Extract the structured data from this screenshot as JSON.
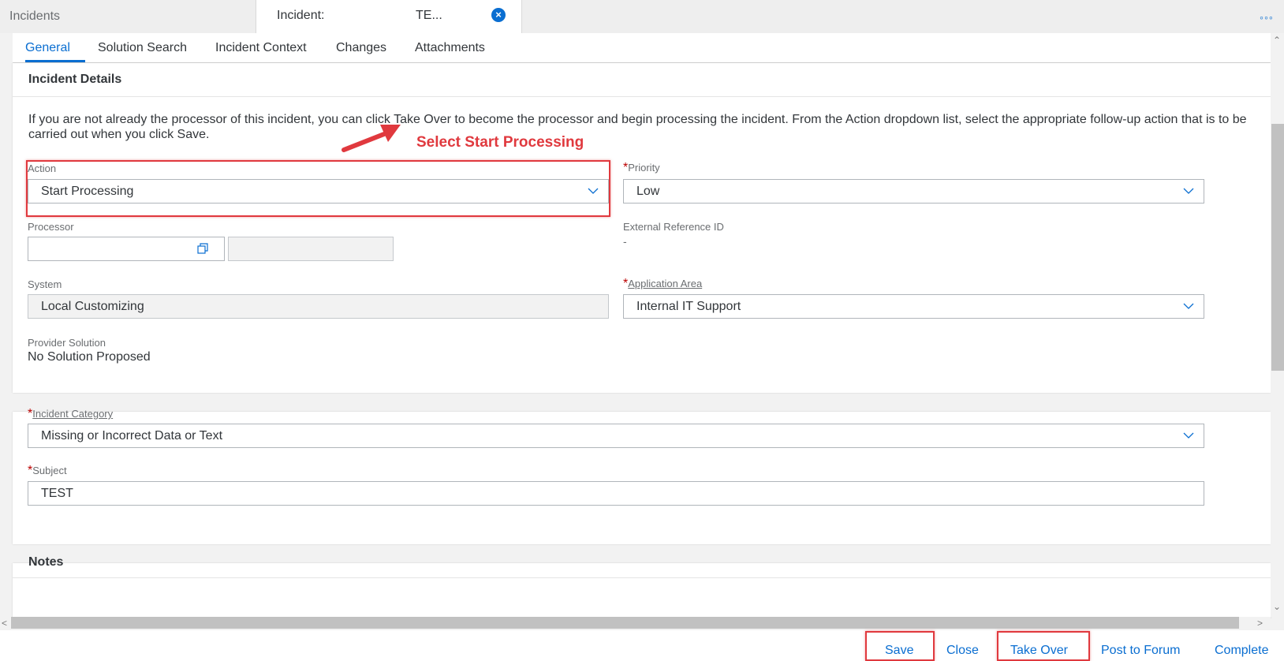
{
  "top_tabs": {
    "incidents_label": "Incidents",
    "incident_label": "Incident:",
    "incident_id": "TE...",
    "close_symbol": "×",
    "overflow_symbol": "◦◦◦"
  },
  "sub_tabs": [
    {
      "label": "General",
      "active": true
    },
    {
      "label": "Solution Search",
      "active": false
    },
    {
      "label": "Incident Context",
      "active": false
    },
    {
      "label": "Changes",
      "active": false
    },
    {
      "label": "Attachments",
      "active": false
    }
  ],
  "details": {
    "title": "Incident Details",
    "info": "If you are not already the processor of this incident, you can click Take Over to become the processor and begin processing the incident. From the Action dropdown list, select the appropriate follow-up action that is to be carried out when you click Save.",
    "action_label": "Action",
    "action_value": "Start Processing",
    "priority_label": "Priority",
    "priority_value": "Low",
    "processor_label": "Processor",
    "processor_value": "",
    "processor_name": "",
    "external_ref_label": "External Reference ID",
    "external_ref_value": "-",
    "system_label": "System",
    "system_value": "Local Customizing",
    "app_area_label": "Application Area",
    "app_area_value": "Internal IT Support",
    "provider_solution_label": "Provider Solution",
    "provider_solution_value": "No Solution Proposed",
    "required_marker": "*"
  },
  "annotation": {
    "text": "Select Start Processing",
    "color": "#e0393e"
  },
  "classification": {
    "category_label": "Incident Category",
    "category_value": "Missing or Incorrect Data or Text",
    "subject_label": "Subject",
    "subject_value": "TEST"
  },
  "notes": {
    "title": "Notes"
  },
  "footer": {
    "save": "Save",
    "close": "Close",
    "take_over": "Take Over",
    "post_to_forum": "Post to Forum",
    "complete": "Complete"
  },
  "colors": {
    "accent": "#0a6ed1",
    "required": "#bb0000",
    "highlight": "#e0393e"
  },
  "icons": {
    "chevron": "chevron-down-icon",
    "value_help": "value-help-icon",
    "close": "close-icon"
  }
}
